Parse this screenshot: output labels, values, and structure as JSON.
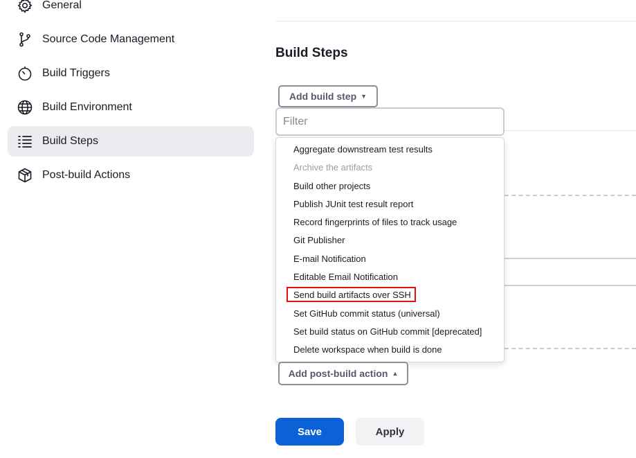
{
  "sidebar": {
    "items": [
      {
        "label": "General",
        "icon": "gear-icon"
      },
      {
        "label": "Source Code Management",
        "icon": "branch-icon"
      },
      {
        "label": "Build Triggers",
        "icon": "timer-icon"
      },
      {
        "label": "Build Environment",
        "icon": "globe-icon"
      },
      {
        "label": "Build Steps",
        "icon": "list-icon",
        "active": true
      },
      {
        "label": "Post-build Actions",
        "icon": "package-icon"
      }
    ]
  },
  "main": {
    "section_title": "Build Steps",
    "add_build_step_label": "Add build step",
    "filter_placeholder": "Filter",
    "dropdown_items": [
      {
        "label": "Aggregate downstream test results",
        "disabled": false
      },
      {
        "label": "Archive the artifacts",
        "disabled": true
      },
      {
        "label": "Build other projects",
        "disabled": false
      },
      {
        "label": "Publish JUnit test result report",
        "disabled": false
      },
      {
        "label": "Record fingerprints of files to track usage",
        "disabled": false
      },
      {
        "label": "Git Publisher",
        "disabled": false
      },
      {
        "label": "E-mail Notification",
        "disabled": false
      },
      {
        "label": "Editable Email Notification",
        "disabled": false
      },
      {
        "label": "Send build artifacts over SSH",
        "disabled": false,
        "highlighted": true
      },
      {
        "label": "Set GitHub commit status (universal)",
        "disabled": false
      },
      {
        "label": "Set build status on GitHub commit [deprecated]",
        "disabled": false
      },
      {
        "label": "Delete workspace when build is done",
        "disabled": false
      }
    ],
    "add_post_build_label": "Add post-build action",
    "save_label": "Save",
    "apply_label": "Apply"
  },
  "colors": {
    "primary": "#0b62d6",
    "highlight": "#e3120b",
    "active_nav_bg": "#ebecf0"
  }
}
